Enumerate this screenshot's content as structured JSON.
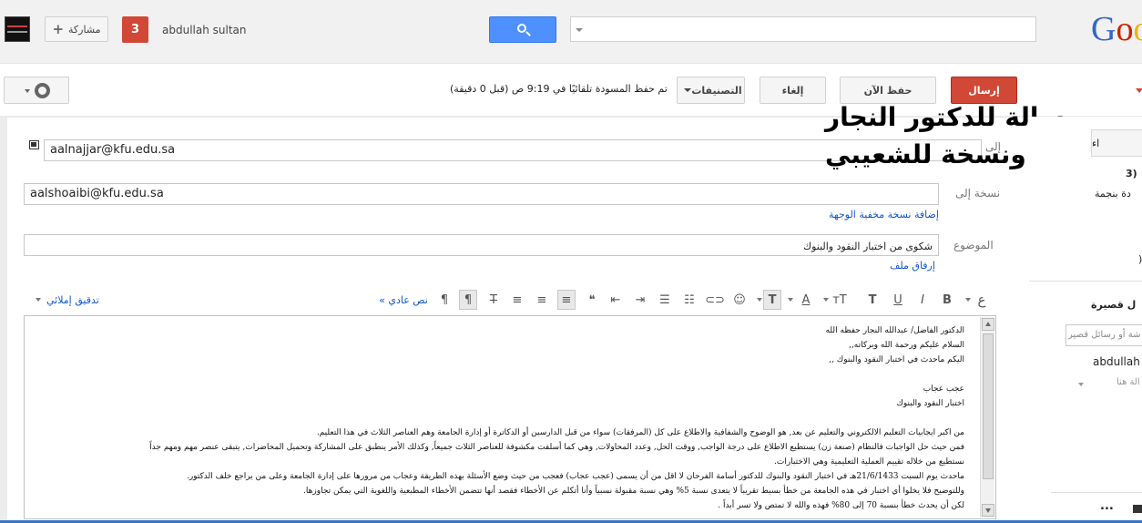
{
  "header": {
    "share_label": "مشاركة",
    "notifications_count": "3",
    "username": "abdullah sultan",
    "search": {
      "value": "",
      "placeholder": ""
    },
    "logo": {
      "part1": "G",
      "part2": "o",
      "part3": "o"
    }
  },
  "toolbar": {
    "send_label": "إرسال",
    "save_now_label": "حفظ الآن",
    "discard_label": "إلغاء",
    "labels_label": "التصنيفات",
    "draft_status": "تم حفظ المسودة تلقائيًا في 9:19 ص (قبل 0 دقيقة)"
  },
  "compose": {
    "to_label": "إلى",
    "to_value": "aalnajjar@kfu.edu.sa",
    "cc_label": "نسخة إلى",
    "cc_value": "aalshoaibi@kfu.edu.sa",
    "add_bcc_link": "إضافة نسخة مخفية الوجهة",
    "subject_label": "الموضوع",
    "subject_value": "شكوى من اختبار النقود والبنوك",
    "attach_link": "إرفاق ملف",
    "overlay_line1": "رسالة للدكتور النجار",
    "overlay_line2": "ونسخة للشعيبي"
  },
  "format_toolbar": {
    "spellcheck_label": "تدقيق إملائي",
    "plain_text_label": "« نص عادي",
    "font_glyph": "ع"
  },
  "body_lines": [
    "الدكتور الفاضل/ عبدالله النجار حفظه الله",
    "السلام عليكم ورحمة الله وبركاته,,",
    "اليكم ماحدث في اختبار النقود والبنوك ,,",
    "",
    "عجب عجاب",
    "اختبار النقود والبنوك",
    "",
    "من اكبر ايجابيات التعليم الالكتروني والتعليم عن بعد, هو الوضوح والشفافية والاطلاع على كل (المرفقات) سواء من قبل الدارسين أو الدكاترة أو إدارة الجامعة وهم العناصر الثلاث في هذا التعليم.",
    "فمن حيث حل الواجبات فالنظام (صنعة زن) يستطيع  الاطلاع على درجة الواجب, ووقت الحل, وعدد المحاولات, وهي كما أسلفت مكشوفة للعناصر الثلاث جميعاً, وكذلك الأمر ينطبق على المشاركة وتحميل المحاضرات, يتبقى عنصر مهم ومهم جداً",
    "نستطيع من خلاله تقييم العملية التعليمية وهي الاختبارات.",
    "ماحدث يوم السبت 21/6/1433هـ في اختبار النقود والبنوك للدكتور أسامة الفرحان لا اقل من أن يسمى (عجب عجاب) فعجب من حيث وضع الأسئلة بهذه الطريقة وعجاب من مرورها على إدارة الجامعة وعلى من يراجع خلف الدكتور.",
    "وللتوضيح فلا يخلوا أي اختبار في هذه الجامعة من خطأ بسيط تقريباً لا يتعدى نسبة 5%  وهي نسبة مقبولة نسبياً وأنا أتكلم عن الأخطاء فقصد أنها تتضمن الأخطاء المطبعية واللغوية التي يمكن تجاوزها.",
    "لكن أن يحدث خطأ بنسبة 70  إلى 80% فهذه والله لا تمتص ولا تسر أبداً .",
    "."
  ],
  "right_panel": {
    "button_fragment": "اء",
    "count_fragment": "(3",
    "starred_fragment": "دة بنجمة",
    "paren_fragment": "(",
    "chat_fragment": "ل قصيرة",
    "search_placeholder": "شة أو رسائل قصير",
    "user_fragment": "abdullah",
    "status_fragment": "الة هنا",
    "more_label": "..."
  }
}
